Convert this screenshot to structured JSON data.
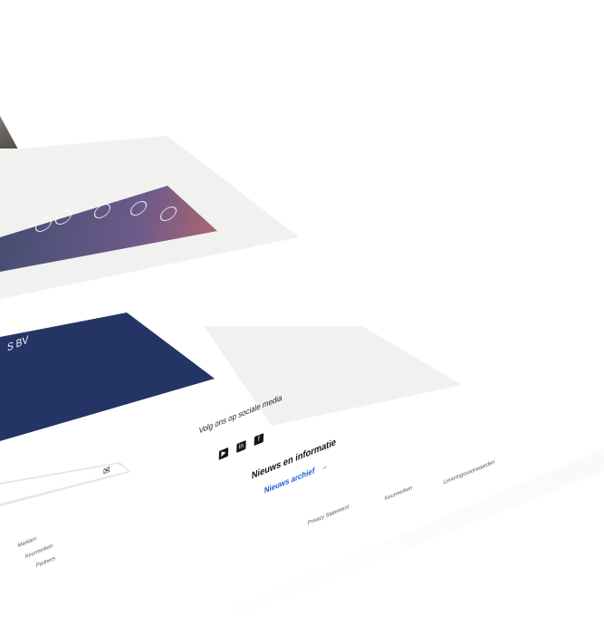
{
  "hero": {
    "company_fragment": "S BV"
  },
  "social": {
    "title": "Volg ons op sociale media",
    "icons": [
      "youtube-icon",
      "linkedin-icon",
      "facebook-icon"
    ]
  },
  "news": {
    "title": "Nieuws en informatie",
    "archive_link": "Nieuws archief"
  },
  "footer": {
    "links": [
      "Privacy Statement",
      "Keurmerken",
      "Leveringsvoorwaarden"
    ],
    "column_links": [
      "Markten",
      "Keurmerken",
      "Partners"
    ]
  },
  "colors": {
    "navy": "#233465",
    "link_blue": "#1f5fd6",
    "band_gray": "#f1f1ef"
  }
}
